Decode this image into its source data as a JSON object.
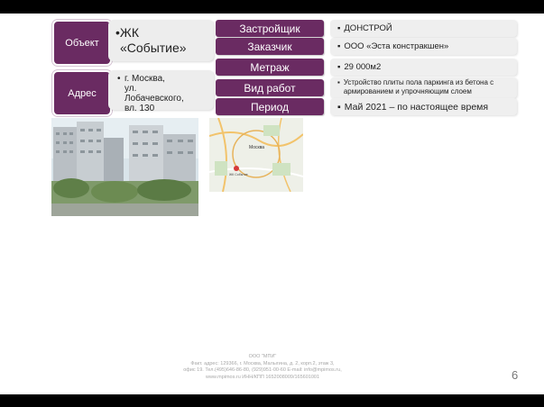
{
  "object": {
    "label": "Объект",
    "value_line1": "ЖК",
    "value_line2": "«Событие»"
  },
  "address": {
    "label": "Адрес",
    "lines": [
      "г. Москва,",
      "ул.",
      "Лобачевского,",
      "вл. 130"
    ]
  },
  "table": [
    {
      "label": "Застройщик",
      "value": "ДОНСТРОЙ"
    },
    {
      "label": "Заказчик",
      "value": "ООО «Эста констракшен»"
    },
    {
      "label": "Метраж",
      "value": "29 000м2"
    },
    {
      "label": "Вид работ",
      "value_line1": "Устройство плиты пола паркинга из бетона с",
      "value_line2": "армированием и упрочняющим слоем"
    },
    {
      "label": "Период",
      "value": "Май  2021 – по настоящее время"
    }
  ],
  "map": {
    "city_label": "Москва",
    "marker_label": "ЖК Событие"
  },
  "footer": {
    "company": "ООО \"МПИ\"",
    "line1": "Факт. адрес: 129366, г. Москва, Малыгина, д. 2, корп.2, этаж 3,",
    "line2": "офис 19. Тел.(495)646-86-80, (929)951-00-60 E-mail: info@mpimos.ru,",
    "line3": "www.mpimos.ru ИНН/КПП 1652008009/165601001"
  },
  "page_number": "6",
  "colors": {
    "accent": "#6a2b62",
    "panel": "#ededed"
  }
}
